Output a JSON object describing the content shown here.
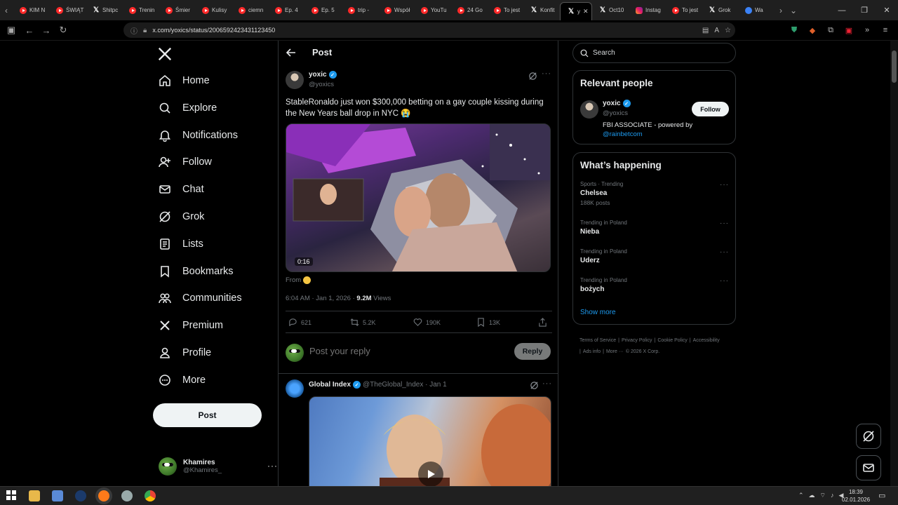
{
  "browser": {
    "tabs": [
      {
        "label": "KIM N",
        "icon": "youtube-icon"
      },
      {
        "label": "ŚWIĄT",
        "icon": "youtube-icon"
      },
      {
        "label": "Shitpc",
        "icon": "x-icon"
      },
      {
        "label": "Trenin",
        "icon": "youtube-icon"
      },
      {
        "label": "Śmier",
        "icon": "youtube-icon"
      },
      {
        "label": "Kulisy",
        "icon": "youtube-icon"
      },
      {
        "label": "ciemn",
        "icon": "youtube-icon"
      },
      {
        "label": "Ep. 4",
        "icon": "youtube-icon"
      },
      {
        "label": "Ep. 5",
        "icon": "youtube-icon"
      },
      {
        "label": "trip -",
        "icon": "youtube-icon"
      },
      {
        "label": "Współ",
        "icon": "youtube-icon"
      },
      {
        "label": "YouTu",
        "icon": "youtube-icon"
      },
      {
        "label": "24 Go",
        "icon": "youtube-icon"
      },
      {
        "label": "To jest",
        "icon": "youtube-icon"
      },
      {
        "label": "Konfit",
        "icon": "x-icon"
      }
    ],
    "active_tab": {
      "label": "y",
      "icon": "x-icon"
    },
    "tabs_after": [
      {
        "label": "Oct10",
        "icon": "x-icon"
      },
      {
        "label": "Instag",
        "icon": "instagram-icon"
      },
      {
        "label": "To jest",
        "icon": "youtube-icon"
      },
      {
        "label": "Grok",
        "icon": "x-icon"
      },
      {
        "label": "Wa",
        "icon": "chrome-icon"
      }
    ],
    "url": "x.com/yoxics/status/2006592423431123450"
  },
  "nav": {
    "items": [
      {
        "label": "Home",
        "icon": "home-icon"
      },
      {
        "label": "Explore",
        "icon": "search-icon"
      },
      {
        "label": "Notifications",
        "icon": "bell-icon"
      },
      {
        "label": "Follow",
        "icon": "follow-icon"
      },
      {
        "label": "Chat",
        "icon": "mail-icon"
      },
      {
        "label": "Grok",
        "icon": "grok-icon"
      },
      {
        "label": "Lists",
        "icon": "list-icon"
      },
      {
        "label": "Bookmarks",
        "icon": "bookmark-icon"
      },
      {
        "label": "Communities",
        "icon": "communities-icon"
      },
      {
        "label": "Premium",
        "icon": "x-icon"
      },
      {
        "label": "Profile",
        "icon": "user-icon"
      },
      {
        "label": "More",
        "icon": "more-circle-icon"
      }
    ],
    "post_label": "Post",
    "account": {
      "name": "Khamires",
      "handle": "@Khamires_"
    }
  },
  "main": {
    "title": "Post",
    "tweet": {
      "name": "yoxic",
      "handle": "@yoxics",
      "text": "StableRonaldo just won $300,000 betting on a gay couple kissing during the New Years ball drop in NYC 😭",
      "duration": "0:16",
      "from_label": "From",
      "time": "6:04 AM · Jan 1, 2026 · ",
      "views_count": "9.2M",
      "views_label": " Views",
      "replies": "621",
      "reposts": "5.2K",
      "likes": "190K",
      "bookmarks": "13K"
    },
    "reply": {
      "placeholder": "Post your reply",
      "button": "Reply"
    },
    "tweet2": {
      "name": "Global Index",
      "handle": "@TheGlobal_Index · Jan 1"
    }
  },
  "right": {
    "search_placeholder": "Search",
    "relevant": {
      "title": "Relevant people",
      "name": "yoxic",
      "handle": "@yoxics",
      "bio": "FBI ASSOCIATE - powered by ",
      "bio_link": "@rainbetcom",
      "follow": "Follow"
    },
    "happening": {
      "title": "What’s happening",
      "trends": [
        {
          "category": "Sports · Trending",
          "name": "Chelsea",
          "posts": "188K posts"
        },
        {
          "category": "Trending in Poland",
          "name": "Nieba",
          "posts": ""
        },
        {
          "category": "Trending in Poland",
          "name": "Uderz",
          "posts": ""
        },
        {
          "category": "Trending in Poland",
          "name": "bożych",
          "posts": ""
        }
      ],
      "show_more": "Show more"
    },
    "footer": [
      "Terms of Service",
      "|",
      "Privacy Policy",
      "|",
      "Cookie Policy",
      "|",
      "Accessibility",
      "|",
      "Ads info",
      "|",
      "More ···",
      "© 2026 X Corp."
    ]
  },
  "taskbar": {
    "time": "18:39",
    "date": "02.01.2026"
  },
  "colors": {
    "accent": "#1d9bf0",
    "background": "#000000",
    "border": "#2f3336",
    "muted": "#71767b"
  }
}
